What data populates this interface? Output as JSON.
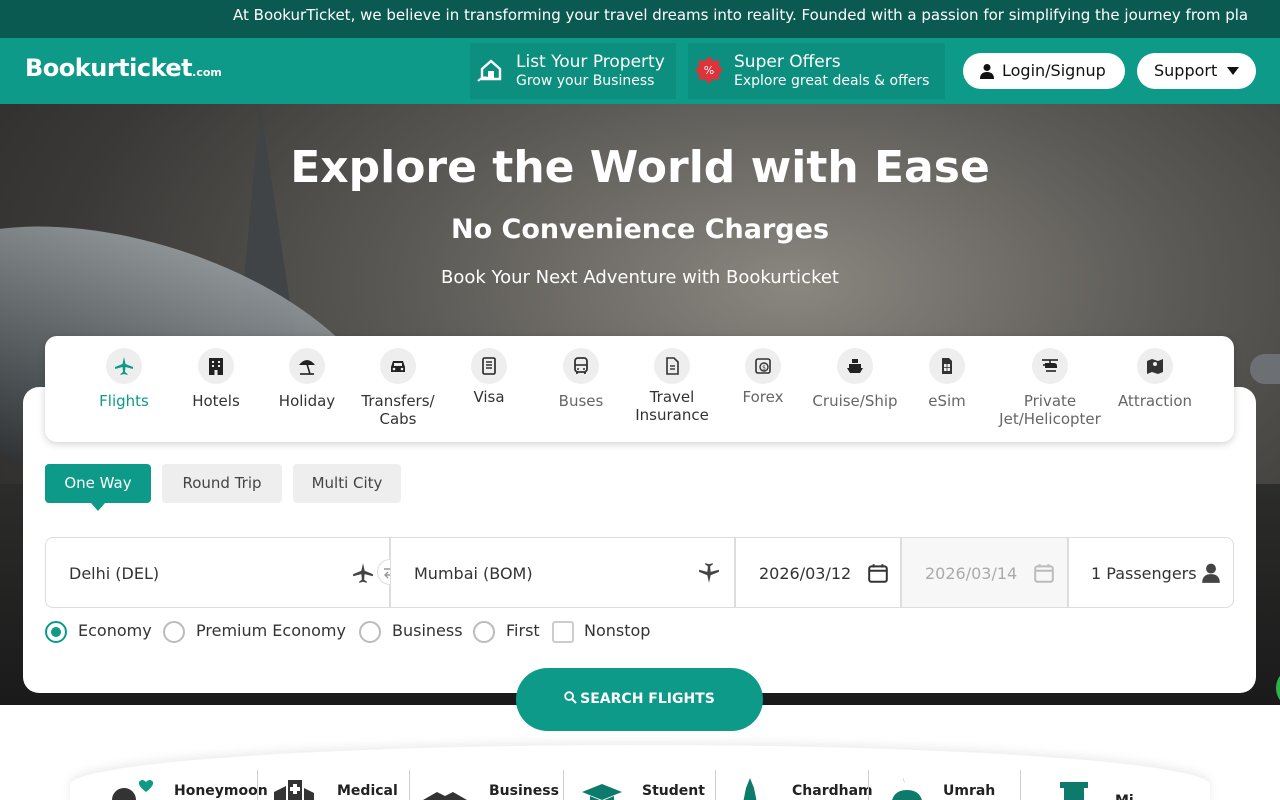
{
  "ticker": "At BookurTicket, we believe in transforming your travel dreams into reality. Founded with a passion for simplifying the journey from pla",
  "header": {
    "logo_main": "Bookurticket",
    "logo_suffix": ".com",
    "list_property": {
      "title": "List Your Property",
      "subtitle": "Grow your Business",
      "icon": "house-hand-icon"
    },
    "super_offers": {
      "title": "Super Offers",
      "subtitle": "Explore great deals & offers",
      "icon": "percent-badge-icon"
    },
    "login": "Login/Signup",
    "support": "Support"
  },
  "hero": {
    "title": "Explore the World with Ease",
    "subtitle": "No Convenience Charges",
    "tagline": "Book Your Next Adventure with Bookurticket"
  },
  "services": [
    {
      "label": "Flights",
      "icon": "airplane-icon",
      "active": true
    },
    {
      "label": "Hotels",
      "icon": "hotel-icon"
    },
    {
      "label": "Holiday",
      "icon": "beach-umbrella-icon"
    },
    {
      "label": "Transfers/ Cabs",
      "icon": "car-icon"
    },
    {
      "label": "Visa",
      "icon": "visa-doc-icon"
    },
    {
      "label": "Buses",
      "icon": "bus-icon"
    },
    {
      "label": "Travel Insurance",
      "icon": "insurance-doc-icon"
    },
    {
      "label": "Forex",
      "icon": "forex-icon"
    },
    {
      "label": "Cruise/Ship",
      "icon": "ship-icon"
    },
    {
      "label": "eSim",
      "icon": "sim-icon"
    },
    {
      "label": "Private Jet/Helicopter",
      "icon": "helicopter-icon"
    },
    {
      "label": "Attraction",
      "icon": "map-icon"
    }
  ],
  "trip_types": [
    {
      "label": "One Way",
      "active": true
    },
    {
      "label": "Round Trip"
    },
    {
      "label": "Multi City"
    }
  ],
  "search": {
    "from": "Delhi (DEL)",
    "to": "Mumbai (BOM)",
    "depart": "2026/03/12",
    "return": "2026/03/14",
    "passengers": "1 Passengers"
  },
  "classes": [
    {
      "label": "Economy",
      "selected": true
    },
    {
      "label": "Premium Economy"
    },
    {
      "label": "Business"
    },
    {
      "label": "First"
    }
  ],
  "nonstop_label": "Nonstop",
  "search_button": "SEARCH FLIGHTS",
  "categories": [
    {
      "label": "Honeymoon",
      "icon": "heart-couple-icon"
    },
    {
      "label": "Medical",
      "icon": "medical-icon"
    },
    {
      "label": "Business",
      "icon": "handshake-icon"
    },
    {
      "label": "Student",
      "icon": "graduation-cap-icon"
    },
    {
      "label": "Chardham",
      "icon": "temple-icon"
    },
    {
      "label": "Umrah",
      "icon": "mosque-icon"
    },
    {
      "label": "Mi",
      "icon": "tower-icon"
    }
  ],
  "colors": {
    "brand": "#0d9a88",
    "ticker_bg": "#0b5a51"
  }
}
